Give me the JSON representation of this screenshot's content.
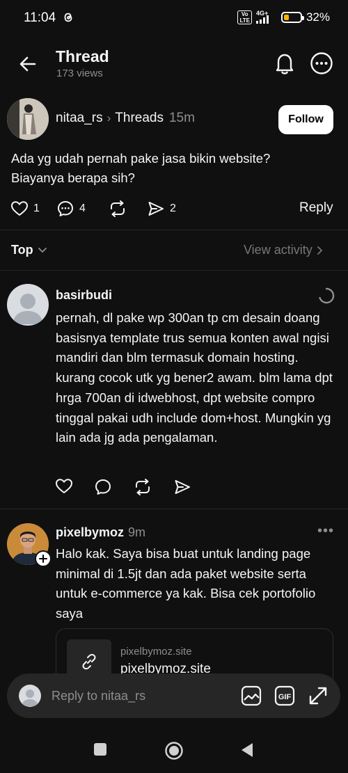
{
  "status_bar": {
    "time": "11:04",
    "volte_label": "Vo\nLTE",
    "network_label": "4G+",
    "battery_percent": "32%",
    "battery_level": 0.32,
    "battery_color": "#ffb300"
  },
  "header": {
    "title": "Thread",
    "views": "173 views",
    "icons": [
      "back-arrow-icon",
      "bell-icon",
      "more-icon"
    ]
  },
  "post": {
    "author": "nitaa_rs",
    "community": "Threads",
    "time": "15m",
    "follow_label": "Follow",
    "text": "Ada yg udah pernah pake jasa bikin website? Biayanya berapa sih?",
    "likes": "1",
    "comments": "4",
    "shares": "2",
    "reply_label": "Reply"
  },
  "sort": {
    "label": "Top",
    "view_activity": "View activity"
  },
  "replies": [
    {
      "author": "basirbudi",
      "time": "",
      "text": "pernah, dl pake wp 300an tp cm desain doang basisnya template trus semua konten awal ngisi mandiri dan blm termasuk domain hosting. kurang cocok utk yg bener2 awam. blm lama dpt hrga 700an di idwebhost, dpt website compro tinggal pakai udh include dom+host. Mungkin yg lain ada jg ada pengalaman."
    },
    {
      "author": "pixelbymoz",
      "time": "9m",
      "more": "•••",
      "text": "Halo kak. Saya bisa buat untuk landing page minimal di 1.5jt dan ada paket website serta untuk e-commerce ya kak. Bisa cek portofolio saya",
      "link": {
        "domain": "pixelbymoz.site",
        "title": "pixelbymoz.site"
      }
    }
  ],
  "composer": {
    "placeholder": "Reply to nitaa_rs",
    "icons": [
      "image-icon",
      "gif-icon",
      "expand-icon"
    ]
  },
  "colors": {
    "background": "#101010",
    "text": "#f3f5f7",
    "secondary": "#8e8e8e",
    "divider": "#262626"
  }
}
